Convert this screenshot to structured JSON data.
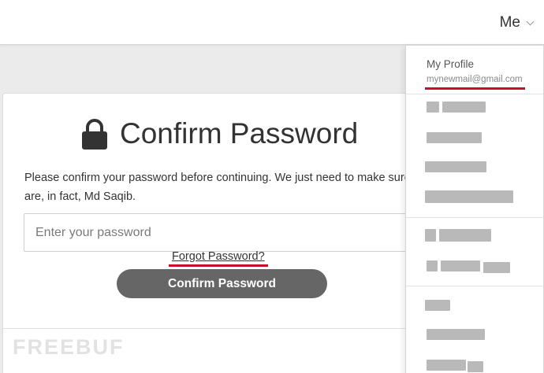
{
  "header": {
    "user_label": "Me"
  },
  "confirm": {
    "title": "Confirm Password",
    "description": "Please confirm your password before continuing. We just need to make sure you are, in fact, Md Saqib.",
    "password_placeholder": "Enter your password",
    "submit_label": "Confirm Password",
    "forgot_label": "Forgot Password?"
  },
  "dropdown": {
    "profile_label": "My Profile",
    "email": "mynewmail@gmail.com"
  },
  "watermark": "FREEBUF",
  "colors": {
    "annotation_red": "#c8102e",
    "button_gray": "#666666"
  }
}
